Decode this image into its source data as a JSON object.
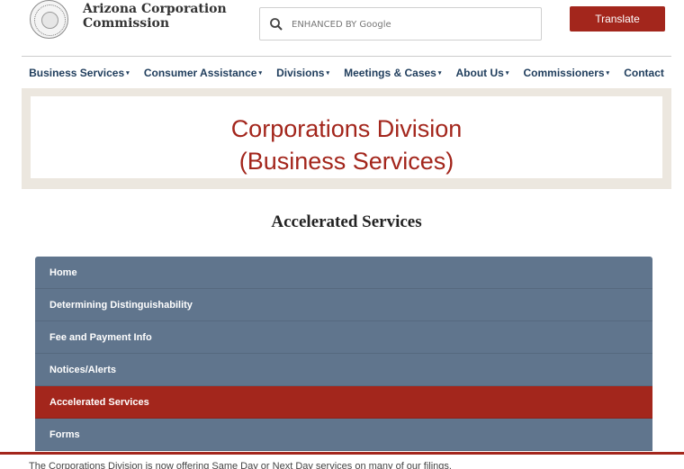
{
  "header": {
    "logo_line1": "Arizona Corporation",
    "logo_line2": "Commission",
    "search_placeholder": "ENHANCED BY Google",
    "translate_label": "Translate"
  },
  "nav": {
    "items": [
      {
        "label": "Business Services",
        "dropdown": true
      },
      {
        "label": "Consumer Assistance",
        "dropdown": true
      },
      {
        "label": "Divisions",
        "dropdown": true
      },
      {
        "label": "Meetings & Cases",
        "dropdown": true
      },
      {
        "label": "About Us",
        "dropdown": true
      },
      {
        "label": "Commissioners",
        "dropdown": true
      },
      {
        "label": "Contact",
        "dropdown": false
      }
    ],
    "caret": "▾"
  },
  "banner": {
    "title_line1": "Corporations Division",
    "title_line2": "(Business Services)"
  },
  "section": {
    "title": "Accelerated Services"
  },
  "side_menu": {
    "items": [
      {
        "label": "Home"
      },
      {
        "label": "Determining Distinguishability"
      },
      {
        "label": "Fee and Payment Info"
      },
      {
        "label": "Notices/Alerts"
      },
      {
        "label": "Accelerated Services",
        "active": true
      },
      {
        "label": "Forms"
      }
    ]
  },
  "content": {
    "intro_text": "The Corporations Division is now offering Same Day or Next Day services on many of our filings."
  },
  "colors": {
    "accent": "#a3261c",
    "nav_text": "#1f3d5c",
    "menu_bg": "#60758d",
    "banner_bg": "#ece7df"
  }
}
